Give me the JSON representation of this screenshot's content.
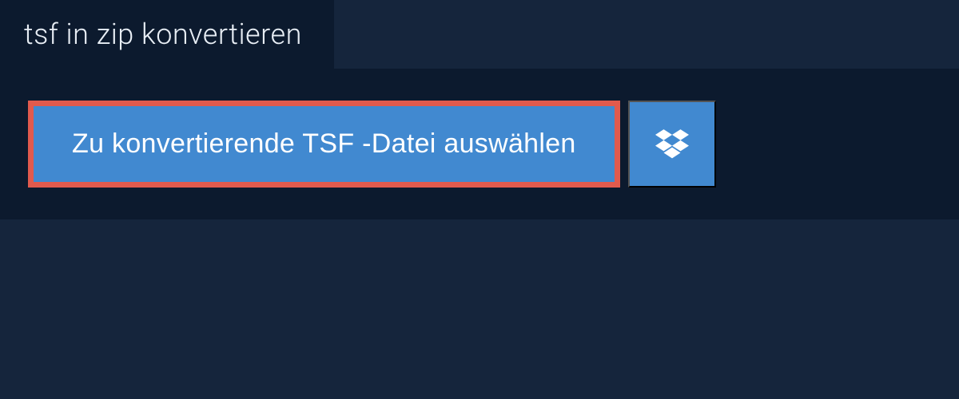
{
  "header": {
    "title": "tsf in zip konvertieren"
  },
  "actions": {
    "select_file_label": "Zu konvertierende TSF -Datei auswählen"
  }
}
